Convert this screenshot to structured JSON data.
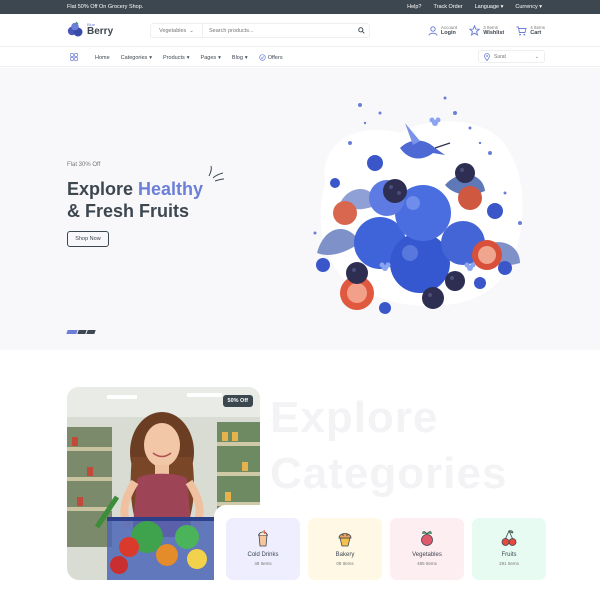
{
  "topbar": {
    "promo": "Flat 50% Off On Grocery Shop.",
    "links": [
      "Help?",
      "Track Order",
      "Language",
      "Currency"
    ]
  },
  "header": {
    "logo_small": "Blue",
    "logo_big": "Berry",
    "search_category": "Vegetables",
    "search_placeholder": "Search products...",
    "account_small": "Account",
    "account_label": "Login",
    "wishlist_small": "3 Items",
    "wishlist_label": "Wishlist",
    "cart_small": "4 Items",
    "cart_label": "Cart"
  },
  "nav": {
    "items": [
      "Home",
      "Categories",
      "Products",
      "Pages",
      "Blog",
      "Offers"
    ],
    "location": "Surat"
  },
  "hero": {
    "tag": "Flat 30% Off",
    "title_line1_a": "Explore ",
    "title_line1_b": "Healthy",
    "title_line2": "& Fresh Fruits",
    "button": "Shop Now"
  },
  "categories": {
    "watermark_line1": "Explore",
    "watermark_line2": "Categories",
    "badge": "50% Off",
    "cards": [
      {
        "name": "Cold Drinks",
        "count": "48 Items",
        "bg": "#eeeefe",
        "icon": "cold-drink-icon"
      },
      {
        "name": "Bakery",
        "count": "08 Items",
        "bg": "#fef8e5",
        "icon": "bakery-icon"
      },
      {
        "name": "Vegetables",
        "count": "485 Items",
        "bg": "#fdeef1",
        "icon": "vegetables-icon"
      },
      {
        "name": "Fruits",
        "count": "291 Items",
        "bg": "#e8fbf2",
        "icon": "fruits-icon"
      }
    ]
  },
  "colors": {
    "primary": "#6c7fd8",
    "dark": "#3d4750",
    "hero_bg": "#f8f8fb"
  }
}
